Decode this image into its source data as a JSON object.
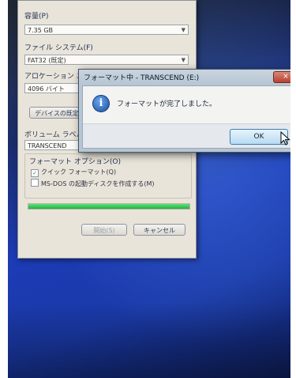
{
  "format_dialog": {
    "capacity_label": "容量(P)",
    "capacity_value": "7.35 GB",
    "filesystem_label": "ファイル システム(F)",
    "filesystem_value": "FAT32 (既定)",
    "allocation_label": "アロケーション ユニ",
    "allocation_value": "4096 バイト",
    "restore_defaults_button": "デバイスの既定",
    "volume_label_label": "ボリューム ラベル(L)",
    "volume_label_value": "TRANSCEND",
    "options_group": "フォーマット オプション(O)",
    "quick_format": "クイック フォーマット(Q)",
    "msdos_disk": "MS-DOS の起動ディスクを作成する(M)",
    "progress": 1.0,
    "start_button": "開始(S)",
    "cancel_button": "キャンセル"
  },
  "message_dialog": {
    "title": "フォーマット中 - TRANSCEND (E:)",
    "close_symbol": "×",
    "info_symbol": "i",
    "message": "フォーマットが完了しました。",
    "ok_button": "OK"
  },
  "colors": {
    "desktop_blue": "#1d3bb5",
    "progress_green": "#1fb33d",
    "dialog_face": "#e9e4d9"
  }
}
